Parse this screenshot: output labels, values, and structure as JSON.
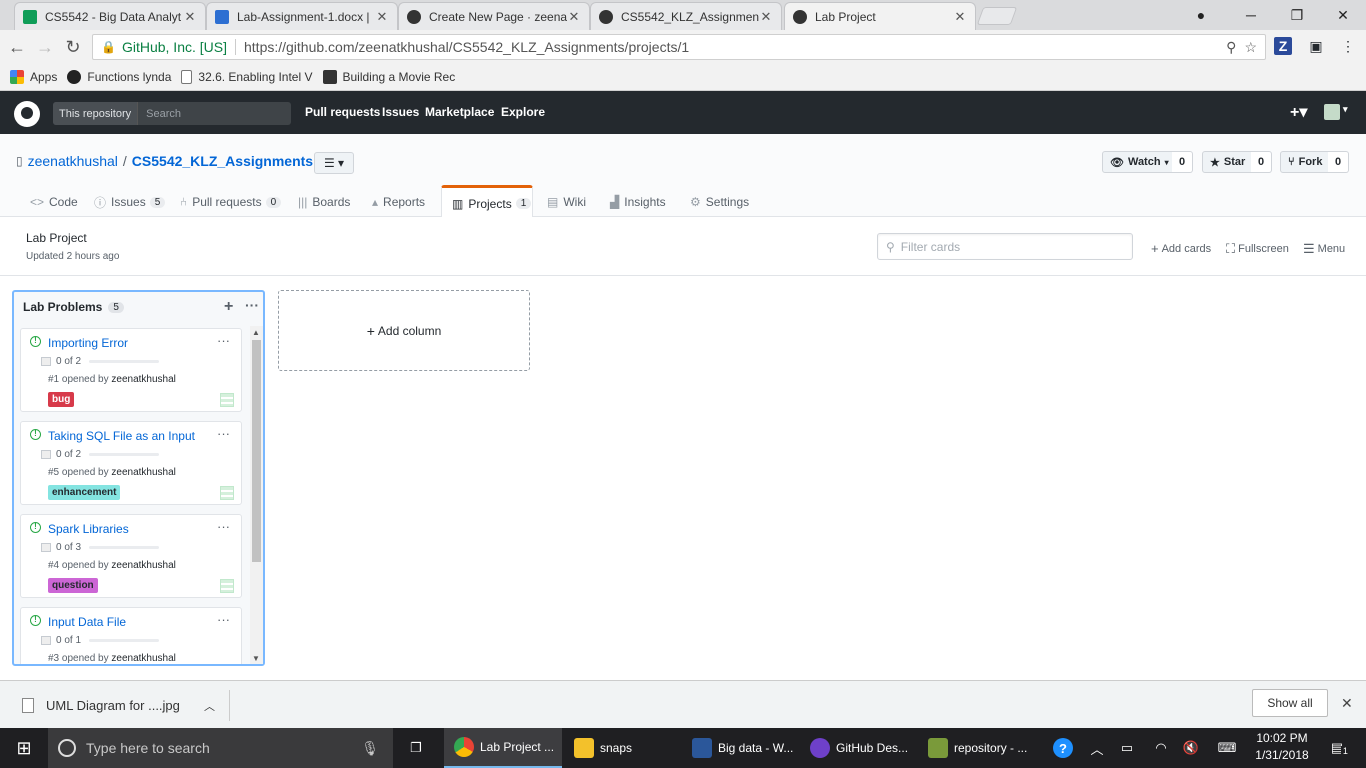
{
  "browser": {
    "tabs": [
      {
        "title": "CS5542 - Big Data Analyt",
        "favcolor": "#0f9d58"
      },
      {
        "title": "Lab-Assignment-1.docx |",
        "favcolor": "#2d6fd2"
      },
      {
        "title": "Create New Page · zeena",
        "favcolor": "#333333"
      },
      {
        "title": "CS5542_KLZ_Assignment",
        "favcolor": "#333333"
      },
      {
        "title": "Lab Project",
        "favcolor": "#333333"
      }
    ],
    "omnibox": {
      "ev": "GitHub, Inc. [US]",
      "url": "https://github.com/zeenatkhushal/CS5542_KLZ_Assignments/projects/1"
    },
    "bookmarks": [
      {
        "label": "Apps"
      },
      {
        "label": "Functions lynda"
      },
      {
        "label": "32.6. Enabling Intel V"
      },
      {
        "label": "Building a Movie Rec"
      }
    ]
  },
  "github": {
    "search_scope": "This repository",
    "search_placeholder": "Search",
    "nav": [
      "Pull requests",
      "Issues",
      "Marketplace",
      "Explore"
    ],
    "owner": "zeenatkhushal",
    "repo": "CS5542_KLZ_Assignments",
    "watch": {
      "label": "Watch",
      "count": "0"
    },
    "star": {
      "label": "Star",
      "count": "0"
    },
    "fork": {
      "label": "Fork",
      "count": "0"
    },
    "tabs": [
      {
        "label": "Code",
        "count": ""
      },
      {
        "label": "Issues",
        "count": "5"
      },
      {
        "label": "Pull requests",
        "count": "0"
      },
      {
        "label": "Boards",
        "count": ""
      },
      {
        "label": "Reports",
        "count": ""
      },
      {
        "label": "Projects",
        "count": "1"
      },
      {
        "label": "Wiki",
        "count": ""
      },
      {
        "label": "Insights",
        "count": ""
      },
      {
        "label": "Settings",
        "count": ""
      }
    ]
  },
  "project": {
    "name": "Lab Project",
    "updated": "Updated 2 hours ago",
    "filter_placeholder": "Filter cards",
    "actions": {
      "add_cards": "Add cards",
      "fullscreen": "Fullscreen",
      "menu": "Menu"
    },
    "column": {
      "name": "Lab Problems",
      "count": "5",
      "cards": [
        {
          "title": "Importing Error",
          "tasks": "0 of 2",
          "number": "#1 opened by",
          "author": "zeenatkhushal",
          "label": "bug",
          "label_bg": "#d73a4a",
          "label_fg": "#ffffff"
        },
        {
          "title": "Taking SQL File as an Input",
          "tasks": "0 of 2",
          "number": "#5 opened by",
          "author": "zeenatkhushal",
          "label": "enhancement",
          "label_bg": "#84e4e1",
          "label_fg": "#24292e"
        },
        {
          "title": "Spark Libraries",
          "tasks": "0 of 3",
          "number": "#4 opened by",
          "author": "zeenatkhushal",
          "label": "question",
          "label_bg": "#cc66d5",
          "label_fg": "#24292e"
        },
        {
          "title": "Input Data File",
          "tasks": "0 of 1",
          "number": "#3 opened by",
          "author": "zeenatkhushal",
          "label": "",
          "label_bg": "",
          "label_fg": ""
        }
      ]
    },
    "add_column": "Add column"
  },
  "download": {
    "file": "UML Diagram for ....jpg",
    "show_all": "Show all"
  },
  "taskbar": {
    "search_placeholder": "Type here to search",
    "apps": [
      {
        "label": "Lab Project ...",
        "color": "#e8453c"
      },
      {
        "label": "snaps",
        "color": "#f3c12b"
      },
      {
        "label": "Big data - W...",
        "color": "#2b579a"
      },
      {
        "label": "GitHub Des...",
        "color": "#6e40c9"
      },
      {
        "label": "repository - ...",
        "color": "#7a9a3a"
      }
    ],
    "time": "10:02 PM",
    "date": "1/31/2018",
    "notif_count": "1"
  }
}
